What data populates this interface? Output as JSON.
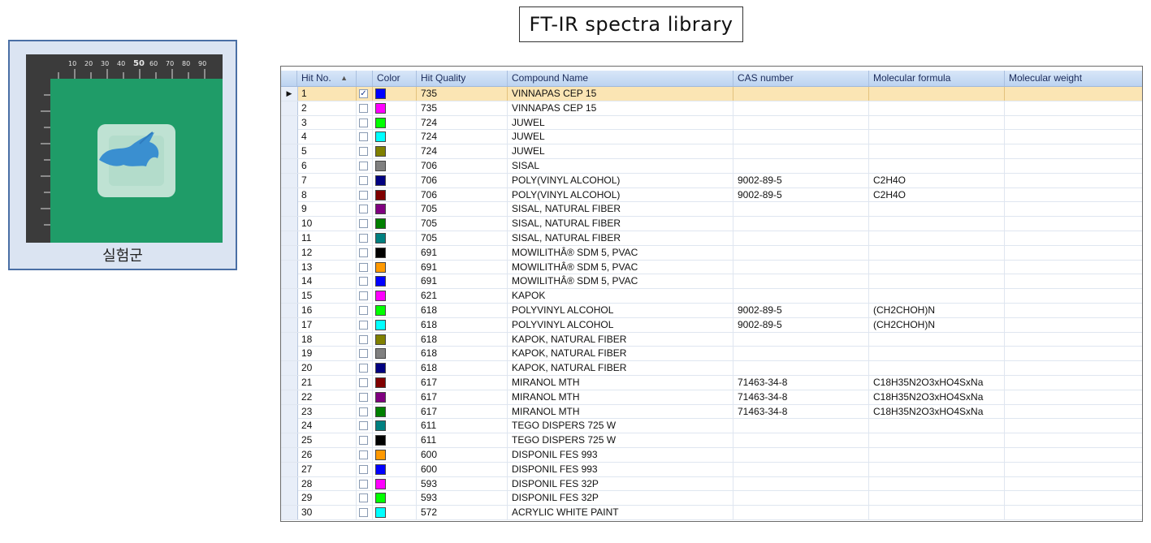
{
  "photo": {
    "caption": "실험군"
  },
  "title": "FT-IR spectra library",
  "grid": {
    "columns": [
      "Hit No.",
      "",
      "Color",
      "Hit Quality",
      "Compound Name",
      "CAS number",
      "Molecular formula",
      "Molecular weight"
    ],
    "sorted_column": "Hit No.",
    "sort_direction": "ascending",
    "selected_row": 1,
    "rows": [
      {
        "hit": "1",
        "checked": true,
        "color": "#0000ff",
        "quality": "735",
        "name": "VINNAPAS CEP 15",
        "cas": "",
        "formula": "",
        "weight": ""
      },
      {
        "hit": "2",
        "checked": false,
        "color": "#ff00ff",
        "quality": "735",
        "name": "VINNAPAS CEP 15",
        "cas": "",
        "formula": "",
        "weight": ""
      },
      {
        "hit": "3",
        "checked": false,
        "color": "#00ff00",
        "quality": "724",
        "name": "JUWEL",
        "cas": "",
        "formula": "",
        "weight": ""
      },
      {
        "hit": "4",
        "checked": false,
        "color": "#00ffff",
        "quality": "724",
        "name": "JUWEL",
        "cas": "",
        "formula": "",
        "weight": ""
      },
      {
        "hit": "5",
        "checked": false,
        "color": "#808000",
        "quality": "724",
        "name": "JUWEL",
        "cas": "",
        "formula": "",
        "weight": ""
      },
      {
        "hit": "6",
        "checked": false,
        "color": "#808080",
        "quality": "706",
        "name": "SISAL",
        "cas": "",
        "formula": "",
        "weight": ""
      },
      {
        "hit": "7",
        "checked": false,
        "color": "#000080",
        "quality": "706",
        "name": "POLY(VINYL ALCOHOL)",
        "cas": "9002-89-5",
        "formula": "C2H4O",
        "weight": ""
      },
      {
        "hit": "8",
        "checked": false,
        "color": "#800000",
        "quality": "706",
        "name": "POLY(VINYL ALCOHOL)",
        "cas": "9002-89-5",
        "formula": "C2H4O",
        "weight": ""
      },
      {
        "hit": "9",
        "checked": false,
        "color": "#800080",
        "quality": "705",
        "name": "SISAL, NATURAL FIBER",
        "cas": "",
        "formula": "",
        "weight": ""
      },
      {
        "hit": "10",
        "checked": false,
        "color": "#008000",
        "quality": "705",
        "name": "SISAL, NATURAL FIBER",
        "cas": "",
        "formula": "",
        "weight": ""
      },
      {
        "hit": "11",
        "checked": false,
        "color": "#008080",
        "quality": "705",
        "name": "SISAL, NATURAL FIBER",
        "cas": "",
        "formula": "",
        "weight": ""
      },
      {
        "hit": "12",
        "checked": false,
        "color": "#000000",
        "quality": "691",
        "name": "MOWILITHÂ® SDM 5, PVAC",
        "cas": "",
        "formula": "",
        "weight": ""
      },
      {
        "hit": "13",
        "checked": false,
        "color": "#ff9900",
        "quality": "691",
        "name": "MOWILITHÂ® SDM 5, PVAC",
        "cas": "",
        "formula": "",
        "weight": ""
      },
      {
        "hit": "14",
        "checked": false,
        "color": "#0000ff",
        "quality": "691",
        "name": "MOWILITHÂ® SDM 5, PVAC",
        "cas": "",
        "formula": "",
        "weight": ""
      },
      {
        "hit": "15",
        "checked": false,
        "color": "#ff00ff",
        "quality": "621",
        "name": "KAPOK",
        "cas": "",
        "formula": "",
        "weight": ""
      },
      {
        "hit": "16",
        "checked": false,
        "color": "#00ff00",
        "quality": "618",
        "name": "POLYVINYL ALCOHOL",
        "cas": "9002-89-5",
        "formula": "(CH2CHOH)N",
        "weight": ""
      },
      {
        "hit": "17",
        "checked": false,
        "color": "#00ffff",
        "quality": "618",
        "name": "POLYVINYL ALCOHOL",
        "cas": "9002-89-5",
        "formula": "(CH2CHOH)N",
        "weight": ""
      },
      {
        "hit": "18",
        "checked": false,
        "color": "#808000",
        "quality": "618",
        "name": "KAPOK, NATURAL FIBER",
        "cas": "",
        "formula": "",
        "weight": ""
      },
      {
        "hit": "19",
        "checked": false,
        "color": "#808080",
        "quality": "618",
        "name": "KAPOK, NATURAL FIBER",
        "cas": "",
        "formula": "",
        "weight": ""
      },
      {
        "hit": "20",
        "checked": false,
        "color": "#000080",
        "quality": "618",
        "name": "KAPOK, NATURAL FIBER",
        "cas": "",
        "formula": "",
        "weight": ""
      },
      {
        "hit": "21",
        "checked": false,
        "color": "#800000",
        "quality": "617",
        "name": "MIRANOL MTH",
        "cas": "71463-34-8",
        "formula": "C18H35N2O3xHO4SxNa",
        "weight": ""
      },
      {
        "hit": "22",
        "checked": false,
        "color": "#800080",
        "quality": "617",
        "name": "MIRANOL MTH",
        "cas": "71463-34-8",
        "formula": "C18H35N2O3xHO4SxNa",
        "weight": ""
      },
      {
        "hit": "23",
        "checked": false,
        "color": "#008000",
        "quality": "617",
        "name": "MIRANOL MTH",
        "cas": "71463-34-8",
        "formula": "C18H35N2O3xHO4SxNa",
        "weight": ""
      },
      {
        "hit": "24",
        "checked": false,
        "color": "#008080",
        "quality": "611",
        "name": "TEGO DISPERS 725 W",
        "cas": "",
        "formula": "",
        "weight": ""
      },
      {
        "hit": "25",
        "checked": false,
        "color": "#000000",
        "quality": "611",
        "name": "TEGO DISPERS 725 W",
        "cas": "",
        "formula": "",
        "weight": ""
      },
      {
        "hit": "26",
        "checked": false,
        "color": "#ff9900",
        "quality": "600",
        "name": "DISPONIL FES 993",
        "cas": "",
        "formula": "",
        "weight": ""
      },
      {
        "hit": "27",
        "checked": false,
        "color": "#0000ff",
        "quality": "600",
        "name": "DISPONIL FES 993",
        "cas": "",
        "formula": "",
        "weight": ""
      },
      {
        "hit": "28",
        "checked": false,
        "color": "#ff00ff",
        "quality": "593",
        "name": "DISPONIL FES 32P",
        "cas": "",
        "formula": "",
        "weight": ""
      },
      {
        "hit": "29",
        "checked": false,
        "color": "#00ff00",
        "quality": "593",
        "name": "DISPONIL FES 32P",
        "cas": "",
        "formula": "",
        "weight": ""
      },
      {
        "hit": "30",
        "checked": false,
        "color": "#00ffff",
        "quality": "572",
        "name": "ACRYLIC WHITE PAINT",
        "cas": "",
        "formula": "",
        "weight": ""
      }
    ]
  }
}
